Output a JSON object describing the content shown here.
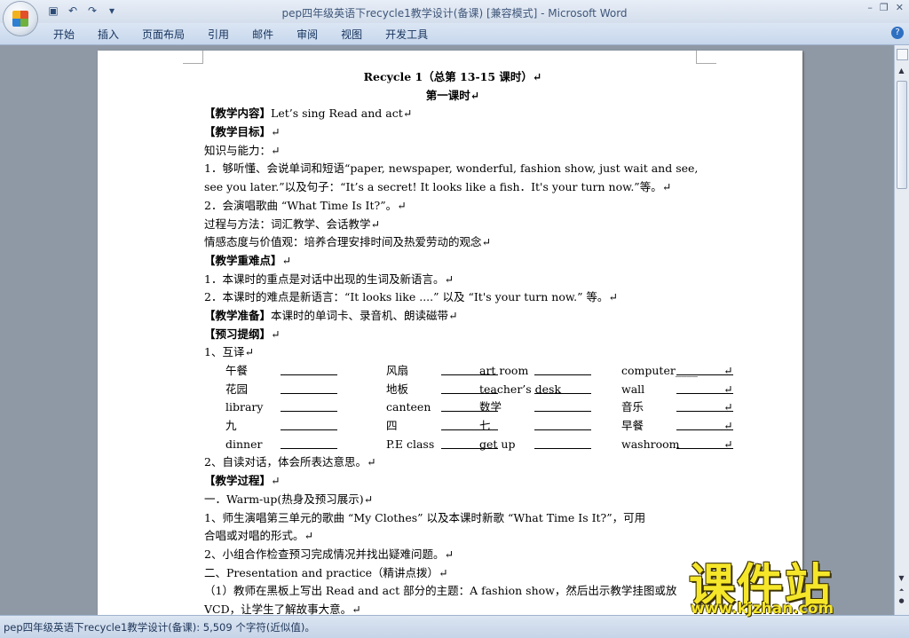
{
  "window": {
    "title": "pep四年级英语下recycle1教学设计(备课) [兼容模式] - Microsoft Word",
    "qat_icons": [
      "save-icon",
      "undo-icon",
      "redo-icon",
      "customize-icon"
    ]
  },
  "ribbon": {
    "tabs": [
      "开始",
      "插入",
      "页面布局",
      "引用",
      "邮件",
      "审阅",
      "视图",
      "开发工具"
    ],
    "help": "?"
  },
  "document": {
    "title": "Recycle 1（总第 13-15 课时）↵",
    "subtitle": "第一课时↵",
    "lines": [
      {
        "label": "【教学内容】",
        "text": "Let’s sing     Read and act↵"
      },
      {
        "label": "【教学目标】",
        "text": "↵"
      },
      {
        "label": "",
        "text": "知识与能力：↵"
      },
      {
        "label": "",
        "text": "        1．够听懂、会说单词和短语“paper, newspaper, wonderful, fashion show, just wait and see,"
      },
      {
        "label": "",
        "text": "see you later.”以及句子：“It’s a secret! It looks like a fish．It's your turn now.”等。↵"
      },
      {
        "label": "",
        "text": "        2．会演唱歌曲 “What Time Is It?”。↵"
      },
      {
        "label": "",
        "text": "过程与方法：词汇教学、会话教学↵"
      },
      {
        "label": "",
        "text": "情感态度与价值观：培养合理安排时间及热爱劳动的观念↵"
      },
      {
        "label": "【教学重难点】",
        "text": "↵"
      },
      {
        "label": "",
        "text": "        1．本课时的重点是对话中出现的生词及新语言。↵"
      },
      {
        "label": "",
        "text": "        2．本课时的难点是新语言：“It looks like ....” 以及 “It's your turn now.” 等。↵"
      },
      {
        "label": "【教学准备】",
        "text": "本课时的单词卡、录音机、朗读磁带↵"
      },
      {
        "label": "【预习提纲】",
        "text": "↵"
      },
      {
        "label": "",
        "text": "1、互译↵"
      }
    ],
    "table_rows": [
      [
        "午餐",
        "风扇",
        "art room",
        "computer____",
        "↵"
      ],
      [
        "花园",
        "地板",
        "teacher’s desk",
        "wall",
        "↵"
      ],
      [
        "library",
        "canteen",
        "数学",
        "音乐",
        "↵"
      ],
      [
        "九",
        "四",
        "七",
        "早餐",
        "↵"
      ],
      [
        "dinner",
        "P.E class",
        "get up",
        "washroom",
        "↵"
      ]
    ],
    "lines2": [
      {
        "label": "",
        "text": "2、自读对话，体会所表达意思。↵"
      },
      {
        "label": "【教学过程】",
        "text": "↵"
      },
      {
        "label": "",
        "text": "一．Warm-up(热身及预习展示)↵"
      },
      {
        "label": "",
        "text": "        1、师生演唱第三单元的歌曲 “My Clothes” 以及本课时新歌 “What Time Is It?”，可用"
      },
      {
        "label": "",
        "text": "合唱或对唱的形式。↵"
      },
      {
        "label": "",
        "text": "        2、小组合作检查预习完成情况并找出疑难问题。↵"
      },
      {
        "label": "",
        "text": "二、Presentation and practice（精讲点拨）↵"
      },
      {
        "label": "",
        "text": "（1）教师在黑板上写出 Read and act 部分的主题：A fashion show，然后出示教学挂图或放"
      },
      {
        "label": "",
        "text": "VCD，让学生了解故事大意。↵"
      }
    ]
  },
  "status": {
    "text": "pep四年级英语下recycle1教学设计(备课): 5,509 个字符(近似值)。"
  },
  "watermark": {
    "brand": "课件站",
    "url": "www.kjzhan.com"
  }
}
